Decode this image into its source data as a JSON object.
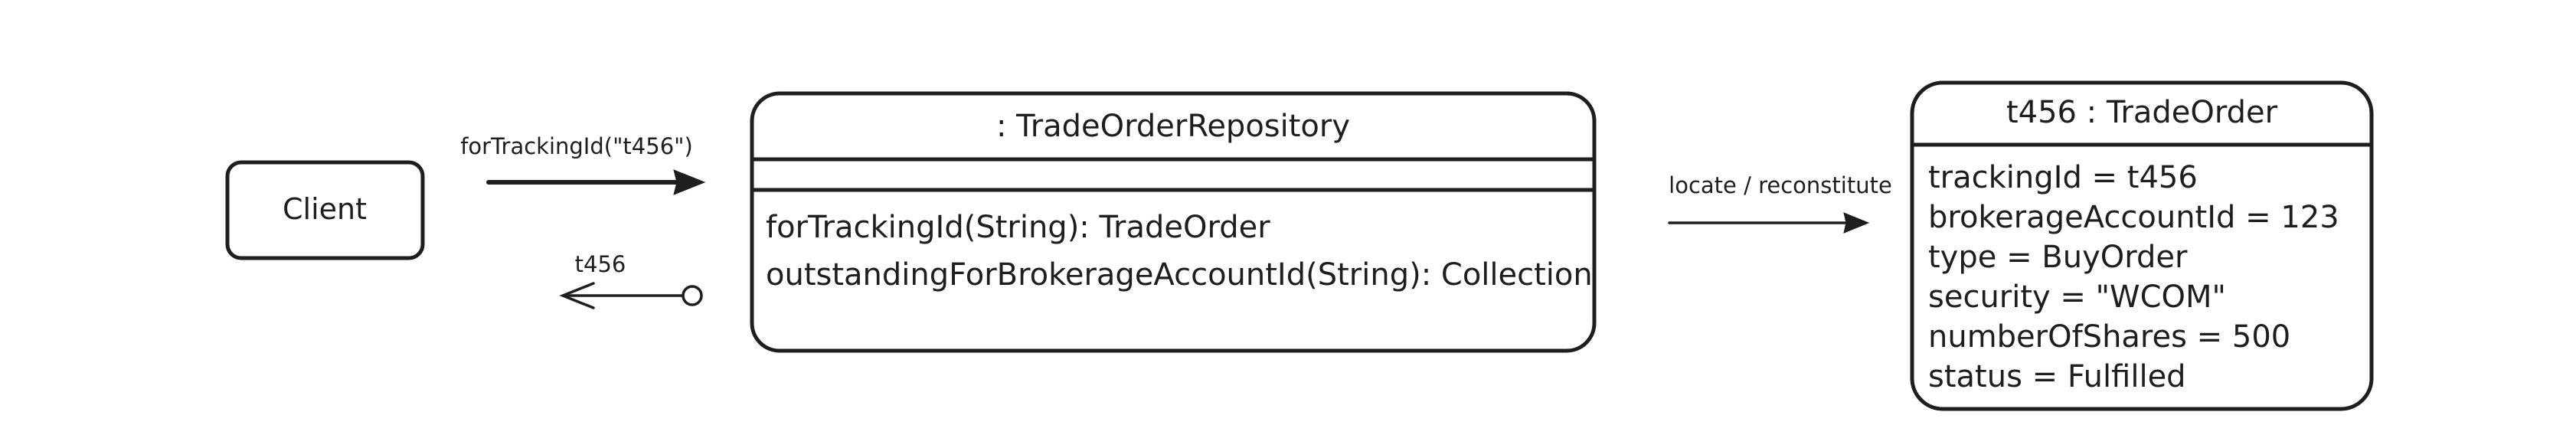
{
  "nodes": {
    "client": {
      "label": "Client"
    },
    "repository": {
      "title": ": TradeOrderRepository",
      "attributes": [],
      "methods": [
        "forTrackingId(String): TradeOrder",
        "outstandingForBrokerageAccountId(String): Collection"
      ]
    },
    "trade_order": {
      "title": "t456 : TradeOrder",
      "fields": [
        "trackingId = t456",
        "brokerageAccountId = 123",
        "type = BuyOrder",
        "security = \"WCOM\"",
        "numberOfShares = 500",
        "status = Fulfilled"
      ]
    }
  },
  "edges": {
    "call": {
      "label": "forTrackingId(\"t456\")"
    },
    "return": {
      "label": "t456"
    },
    "locate": {
      "label": "locate / reconstitute"
    }
  }
}
